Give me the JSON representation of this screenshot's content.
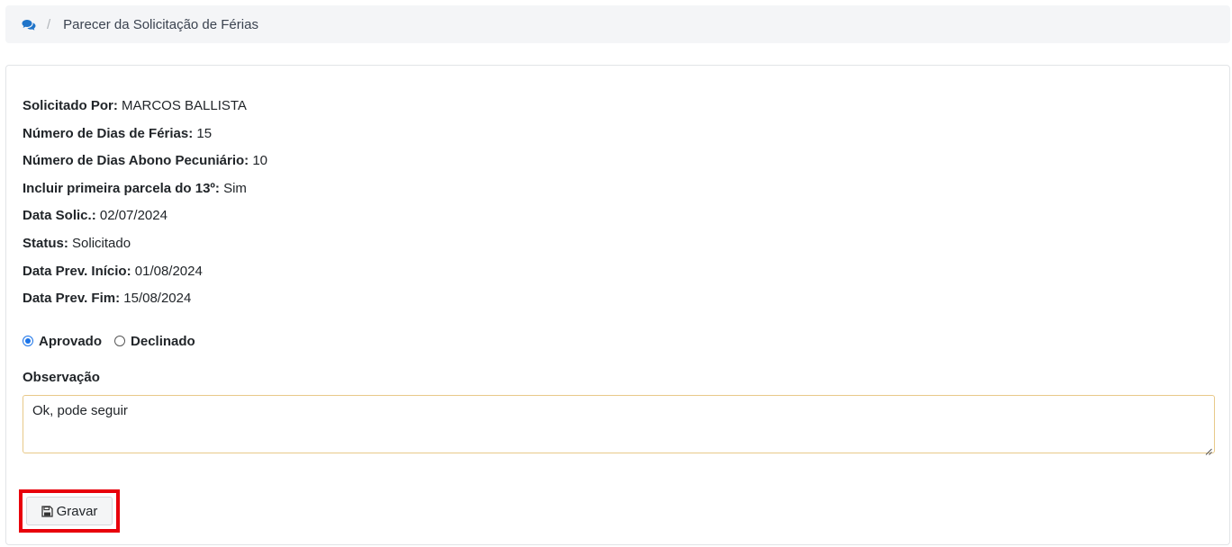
{
  "breadcrumb": {
    "icon": "comments-icon",
    "separator": "/",
    "title": "Parecer da Solicitação de Férias"
  },
  "details": [
    {
      "label": "Solicitado Por:",
      "value": "MARCOS BALLISTA"
    },
    {
      "label": "Número de Dias de Férias:",
      "value": "15"
    },
    {
      "label": "Número de Dias Abono Pecuniário:",
      "value": "10"
    },
    {
      "label": "Incluir primeira parcela do 13º:",
      "value": "Sim"
    },
    {
      "label": "Data Solic.:",
      "value": "02/07/2024"
    },
    {
      "label": "Status:",
      "value": "Solicitado"
    },
    {
      "label": "Data Prev. Início:",
      "value": "01/08/2024"
    },
    {
      "label": "Data Prev. Fim:",
      "value": "15/08/2024"
    }
  ],
  "decision": {
    "options": [
      {
        "label": "Aprovado",
        "checked": true
      },
      {
        "label": "Declinado",
        "checked": false
      }
    ]
  },
  "observation": {
    "label": "Observação",
    "value": "Ok, pode seguir"
  },
  "actions": {
    "save_label": "Gravar",
    "save_icon": "floppy-disk-icon"
  },
  "colors": {
    "accent": "#1a73e8",
    "highlight": "#e8000b",
    "textarea_border": "#e8c989"
  }
}
